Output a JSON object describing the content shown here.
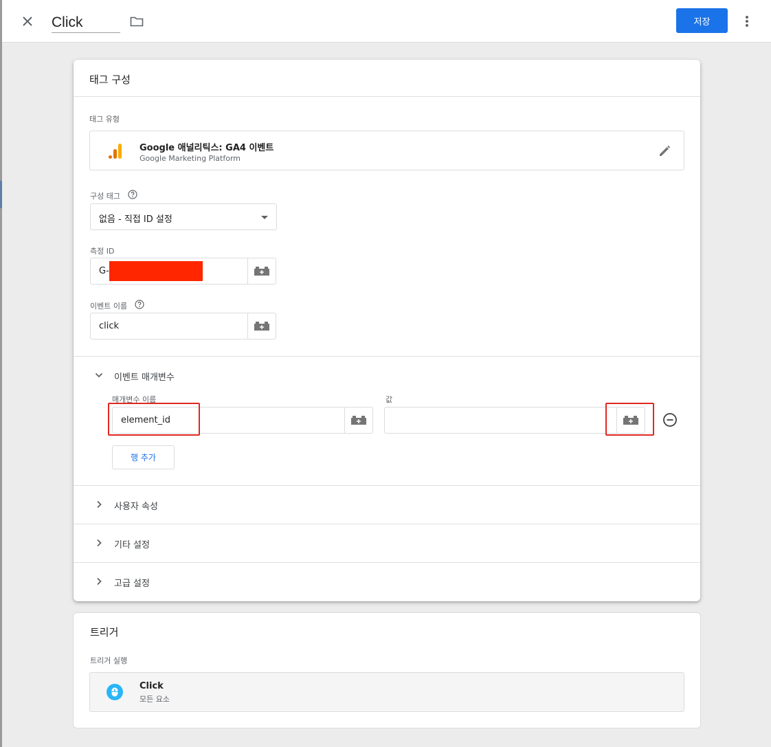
{
  "header": {
    "tag_name": "Click",
    "save_label": "저장"
  },
  "tag_config": {
    "title": "태그 구성",
    "tag_type_label": "태그 유형",
    "tag_type_name": "Google 애널리틱스: GA4 이벤트",
    "tag_type_platform": "Google Marketing Platform",
    "config_tag_label": "구성 태그",
    "config_tag_value": "없음 - 직접 ID 설정",
    "measurement_id_label": "측정 ID",
    "measurement_id_value": "G-",
    "event_name_label": "이벤트 이름",
    "event_name_value": "click",
    "event_params": {
      "title": "이벤트 매개변수",
      "param_name_label": "매개변수 이름",
      "value_label": "값",
      "rows": [
        {
          "name": "element_id",
          "value": ""
        }
      ],
      "add_row_label": "행 추가"
    },
    "user_properties_label": "사용자 속성",
    "other_settings_label": "기타 설정",
    "advanced_settings_label": "고급 설정"
  },
  "trigger": {
    "title": "트리거",
    "firing_label": "트리거 실행",
    "trigger_name": "Click",
    "trigger_sub": "모든 요소"
  },
  "colors": {
    "accent": "#1a73e8",
    "highlight": "#e0281f",
    "redaction": "#ff2600",
    "analytics_orange": "#f9ab00",
    "analytics_dark_orange": "#e37400",
    "trigger_icon": "#29b6f6"
  },
  "icons": {
    "close": "close-icon",
    "folder": "folder-icon",
    "more": "more-vert-icon",
    "analytics": "analytics-icon",
    "edit": "pencil-icon",
    "help": "help-circle-icon",
    "variable": "variable-brick-icon",
    "remove": "remove-circle-icon",
    "mouse": "mouse-icon"
  }
}
